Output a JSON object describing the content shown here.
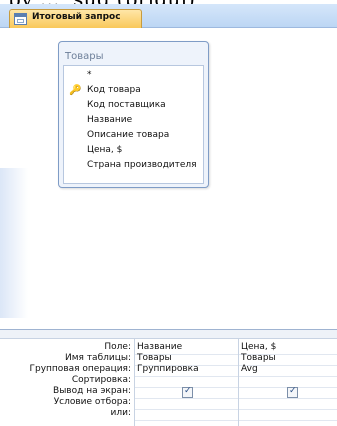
{
  "top_fragment": "ру ..., sug (priduj)",
  "tab": {
    "label": "Итоговый запрос",
    "icon": "query-icon"
  },
  "table": {
    "title": "Товары",
    "fields": [
      "*",
      "Код товара",
      "Код поставщика",
      "Название",
      "Описание товара",
      "Цена, $",
      "Страна производителя"
    ],
    "key_field": "Код товара"
  },
  "scrollbar": {
    "left_arrow": "◀"
  },
  "grid": {
    "row_labels": [
      "Поле:",
      "Имя таблицы:",
      "Групповая операция:",
      "Сортировка:",
      "Вывод на экран:",
      "Условие отбора:",
      "или:"
    ],
    "columns": [
      {
        "field": "Название",
        "table": "Товары",
        "group": "Группировка",
        "sort": "",
        "show": true,
        "criteria": "",
        "or": ""
      },
      {
        "field": "Цена, $",
        "table": "Товары",
        "group": "Avg",
        "sort": "",
        "show": true,
        "criteria": "",
        "or": ""
      }
    ]
  },
  "colors": {
    "tab_active": "#f9c85a",
    "pane_border": "#7f9cc6",
    "key_icon": "#c89a19"
  }
}
